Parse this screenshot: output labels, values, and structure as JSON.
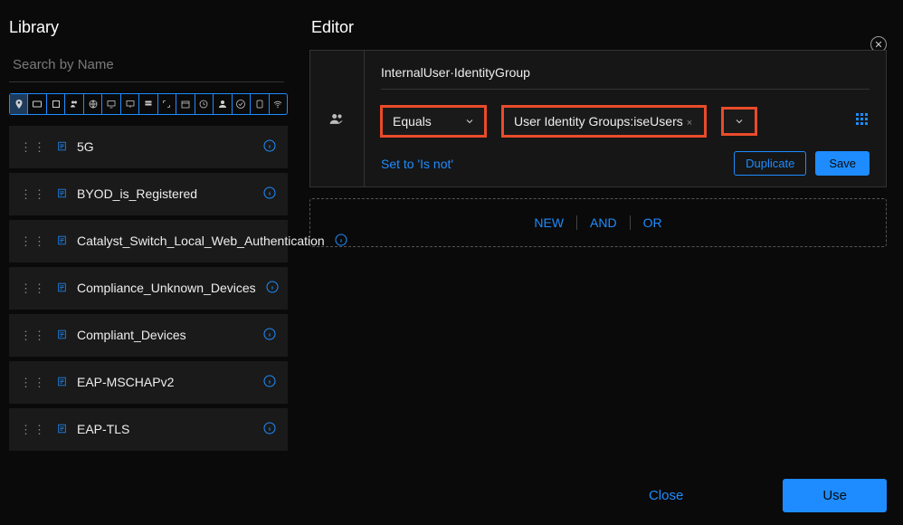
{
  "library": {
    "title": "Library",
    "search_placeholder": "Search by Name",
    "items": [
      {
        "label": "5G"
      },
      {
        "label": "BYOD_is_Registered"
      },
      {
        "label": "Catalyst_Switch_Local_Web_Authentication"
      },
      {
        "label": "Compliance_Unknown_Devices"
      },
      {
        "label": "Compliant_Devices"
      },
      {
        "label": "EAP-MSCHAPv2"
      },
      {
        "label": "EAP-TLS"
      }
    ]
  },
  "editor": {
    "title": "Editor",
    "attribute": "InternalUser·IdentityGroup",
    "operator": "Equals",
    "value": "User Identity Groups:iseUsers",
    "set_link": "Set to 'Is not'",
    "duplicate": "Duplicate",
    "save": "Save",
    "add_options": {
      "new": "NEW",
      "and": "AND",
      "or": "OR"
    }
  },
  "footer": {
    "close": "Close",
    "use": "Use"
  }
}
